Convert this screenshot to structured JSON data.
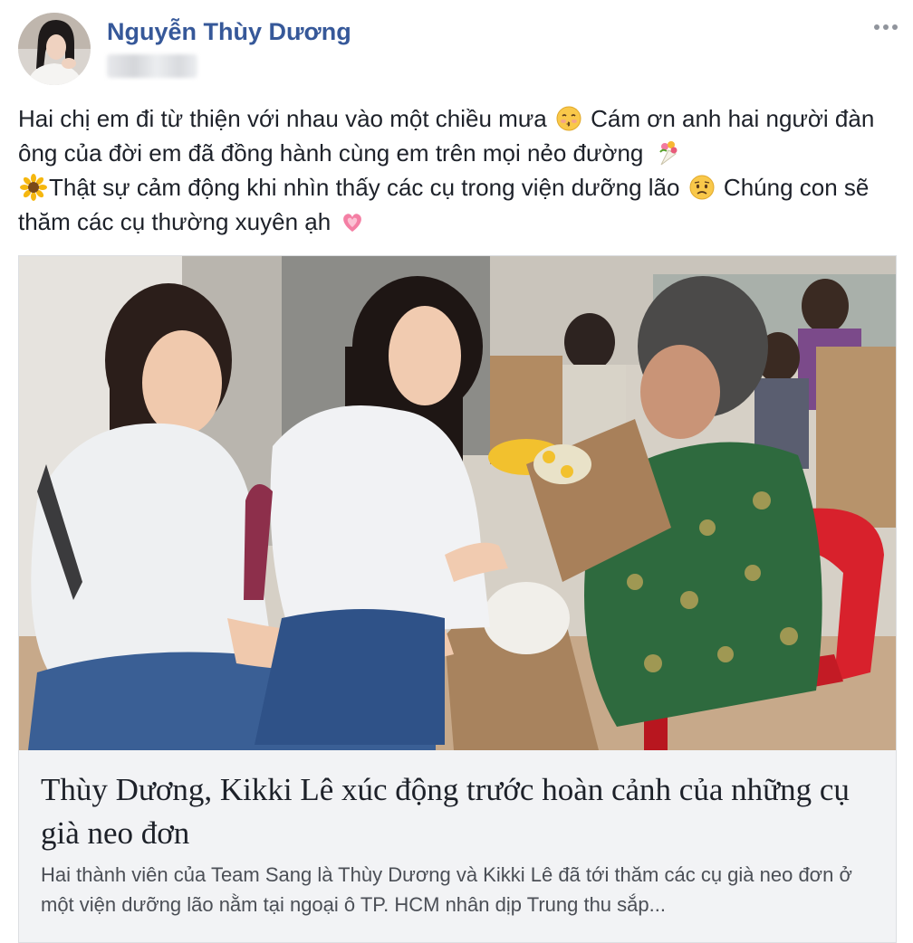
{
  "post": {
    "author_name": "Nguyễn Thùy Dương",
    "text_segments": [
      "Hai chị em đi từ thiện với nhau vào một chiều mưa",
      " Cám ơn anh hai người đàn ông của đời em đã đồng hành cùng em trên mọi nẻo đường ",
      "Thật sự cảm động khi nhìn thấy các cụ trong viện dưỡng lão",
      " Chúng con sẽ thăm các cụ thường xuyên ạh "
    ],
    "emojis": [
      "kissing-face-icon",
      "bouquet-icon",
      "sunflower-icon",
      "worried-face-icon",
      "growing-heart-icon"
    ]
  },
  "link_card": {
    "title": "Thùy Dương, Kikki Lê xúc động trước hoàn cảnh của những cụ già neo đơn",
    "description": "Hai thành viên của Team Sang là Thùy Dương và Kikki Lê đã tới thăm các cụ già neo đơn ở một viện dưỡng lão nằm tại ngoại ô TP. HCM nhân dịp Trung thu sắp..."
  },
  "colors": {
    "author_name": "#365899",
    "text": "#1d2129",
    "description": "#4b4f56",
    "card_background": "#f2f3f5",
    "card_border": "#dddfe2",
    "more_dots": "#90949c"
  }
}
